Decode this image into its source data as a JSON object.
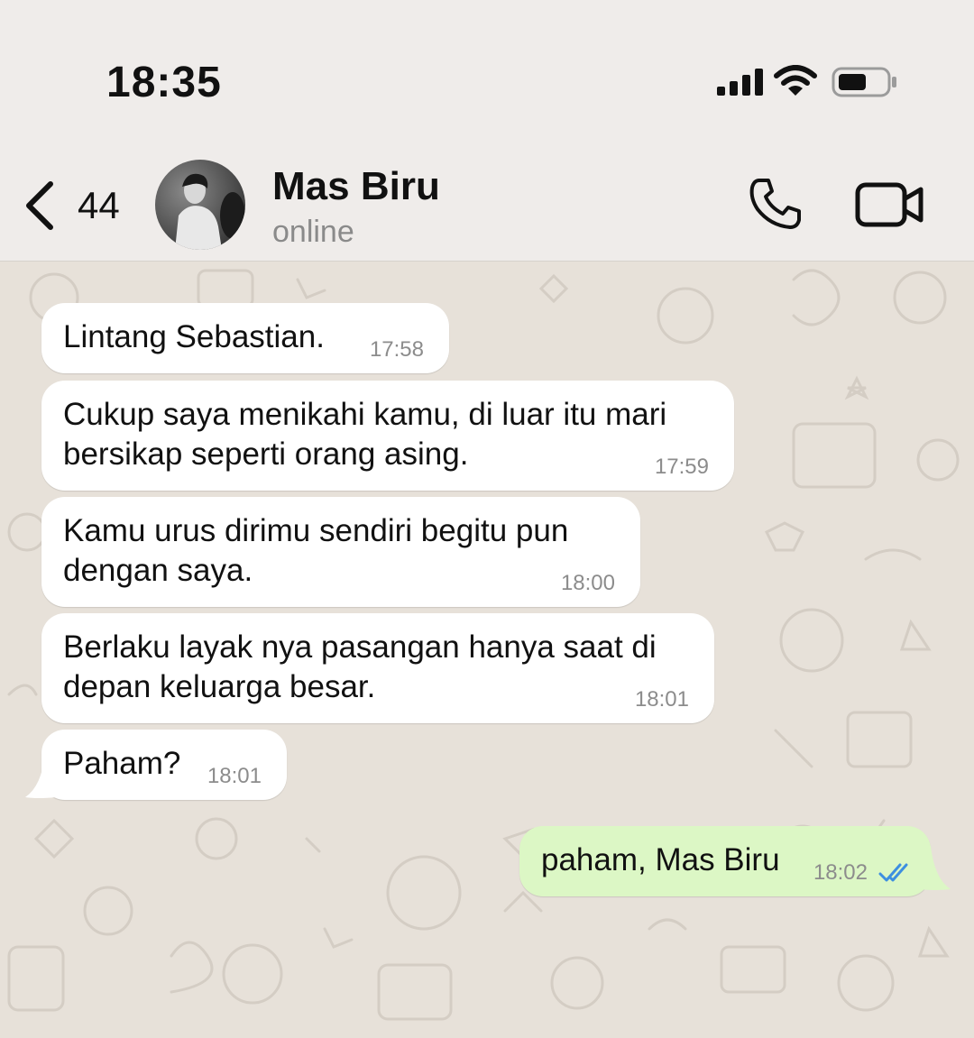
{
  "status_bar": {
    "time": "18:35"
  },
  "header": {
    "back_count": "44",
    "contact_name": "Mas Biru",
    "contact_status": "online"
  },
  "messages": [
    {
      "text": "Lintang Sebastian.",
      "time": "17:58",
      "direction": "incoming"
    },
    {
      "text": "Cukup saya menikahi kamu, di luar itu mari bersikap seperti orang asing.",
      "time": "17:59",
      "direction": "incoming"
    },
    {
      "text": "Kamu urus dirimu sendiri begitu pun dengan saya.",
      "time": "18:00",
      "direction": "incoming"
    },
    {
      "text": "Berlaku layak nya pasangan hanya saat di depan keluarga besar.",
      "time": "18:01",
      "direction": "incoming"
    },
    {
      "text": "Paham?",
      "time": "18:01",
      "direction": "incoming"
    },
    {
      "text": "paham, Mas Biru",
      "time": "18:02",
      "direction": "outgoing",
      "status": "read"
    }
  ],
  "colors": {
    "chat_background": "#e7e1d9",
    "header_background": "#efecea",
    "incoming_bubble": "#ffffff",
    "outgoing_bubble": "#dcf7c5",
    "read_ticks": "#3d8fe0"
  },
  "icons": {
    "back": "chevron-left-icon",
    "call": "phone-icon",
    "video": "video-camera-icon",
    "signal": "cellular-signal-icon",
    "wifi": "wifi-icon",
    "battery": "battery-icon",
    "read_receipt": "double-check-icon"
  }
}
